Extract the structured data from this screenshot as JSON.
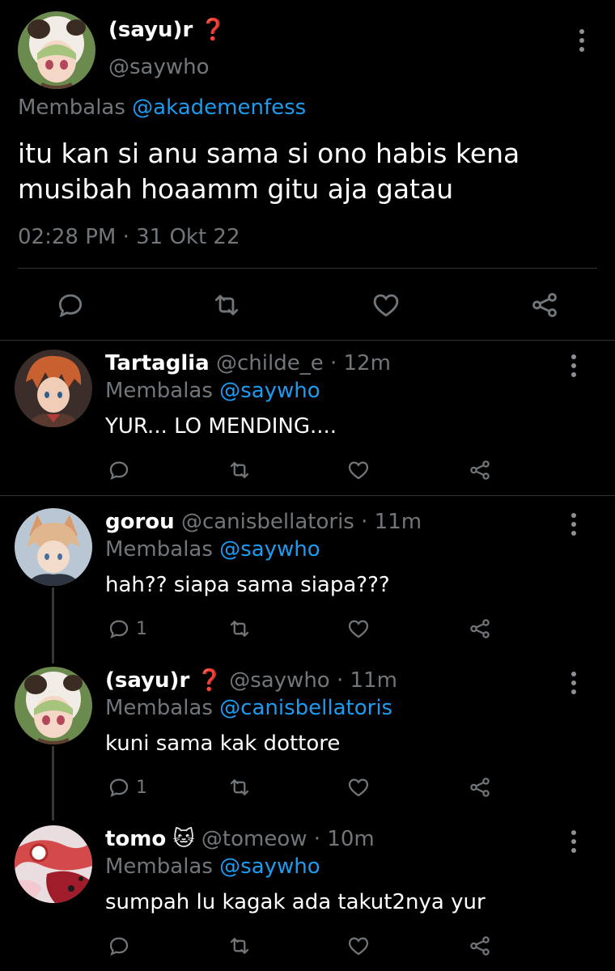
{
  "main_tweet": {
    "name": "(sayu)r",
    "name_emoji": "❓",
    "handle": "@saywho",
    "replying_prefix": "Membalas",
    "replying_to": "@akademenfess",
    "text_line1": "itu kan si anu sama si ono habis kena",
    "text_line2": "musibah hoaamm gitu aja gatau",
    "timestamp": "02:28 PM · 31 Okt 22"
  },
  "replies": [
    {
      "name": "Tartaglia",
      "handle": "@childe_e",
      "time": "· 12m",
      "replying_prefix": "Membalas",
      "replying_to": "@saywho",
      "text": "YUR... LO MENDING....",
      "reply_count": ""
    },
    {
      "name": "gorou",
      "handle": "@canisbellatoris",
      "time": "· 11m",
      "replying_prefix": "Membalas",
      "replying_to": "@saywho",
      "text": "hah?? siapa sama siapa???",
      "reply_count": "1"
    },
    {
      "name": "(sayu)r",
      "name_emoji": "❓",
      "handle": "@saywho",
      "time": "· 11m",
      "replying_prefix": "Membalas",
      "replying_to": "@canisbellatoris",
      "text": "kuni sama kak dottore",
      "reply_count": "1"
    },
    {
      "name": "tomo",
      "name_emoji": "🐱",
      "handle": "@tomeow",
      "time": "· 10m",
      "replying_prefix": "Membalas",
      "replying_to": "@saywho",
      "text": "sumpah lu kagak ada takut2nya yur",
      "reply_count": ""
    }
  ],
  "icons": {
    "reply": "reply-icon",
    "retweet": "retweet-icon",
    "like": "heart-icon",
    "share": "share-icon",
    "more": "more-vertical-icon"
  },
  "colors": {
    "background": "#000000",
    "link": "#1d9bf0",
    "muted": "#71767b",
    "text": "#e7e9ea"
  }
}
